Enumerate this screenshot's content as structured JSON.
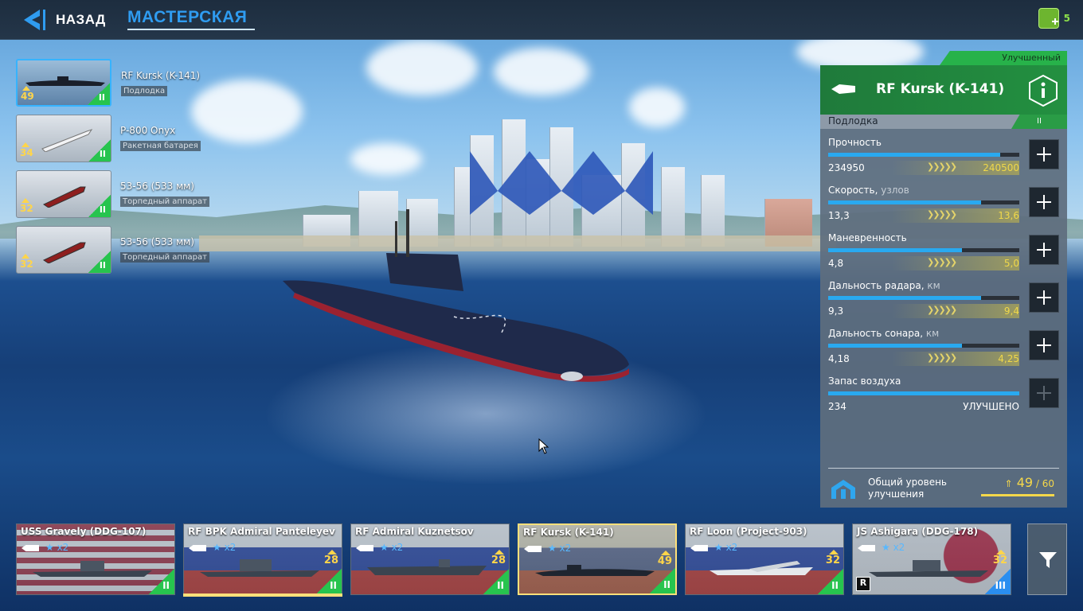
{
  "header": {
    "back_label": "НАЗАД",
    "title": "МАСТЕРСКАЯ",
    "currency_count": "5"
  },
  "loadout": [
    {
      "name": "RF Kursk (K-141)",
      "type": "Подлодка",
      "level": "49",
      "tier": "II",
      "selected": true
    },
    {
      "name": "P-800 Onyx",
      "type": "Ракетная батарея",
      "level": "34",
      "tier": "II",
      "selected": false
    },
    {
      "name": "53-56 (533 мм)",
      "type": "Торпедный аппарат",
      "level": "32",
      "tier": "II",
      "selected": false
    },
    {
      "name": "53-56 (533 мм)",
      "type": "Торпедный аппарат",
      "level": "32",
      "tier": "II",
      "selected": false
    }
  ],
  "panel": {
    "rarity": "Улучшенный",
    "ship_name": "RF Kursk (K-141)",
    "class_label": "Подлодка",
    "tier": "II",
    "stats": [
      {
        "label": "Прочность",
        "unit": "",
        "value": "234950",
        "max": "240500",
        "fill_percent": 90,
        "upgraded": false
      },
      {
        "label": "Скорость,",
        "unit": " узлов",
        "value": "13,3",
        "max": "13,6",
        "fill_percent": 80,
        "upgraded": false
      },
      {
        "label": "Маневренность",
        "unit": "",
        "value": "4,8",
        "max": "5,0",
        "fill_percent": 70,
        "upgraded": false
      },
      {
        "label": "Дальность радара,",
        "unit": " км",
        "value": "9,3",
        "max": "9,4",
        "fill_percent": 80,
        "upgraded": false
      },
      {
        "label": "Дальность сонара,",
        "unit": " км",
        "value": "4,18",
        "max": "4,25",
        "fill_percent": 70,
        "upgraded": false
      },
      {
        "label": "Запас воздуха",
        "unit": "",
        "value": "234",
        "max": "УЛУЧШЕНО",
        "fill_percent": 100,
        "upgraded": true
      }
    ],
    "arrows": "❯❯❯❯❯",
    "total_label_1": "Общий уровень",
    "total_label_2": "улучшения",
    "total_current": "49",
    "total_sep": " / ",
    "total_max": "60"
  },
  "fleet": [
    {
      "name": "USS Gravely (DDG-107)",
      "stars": "x2",
      "level": "",
      "tier": "II",
      "flag": "us",
      "active": false
    },
    {
      "name": "RF BPK Admiral Panteleyev",
      "stars": "x2",
      "level": "28",
      "tier": "II",
      "flag": "ru",
      "active": false
    },
    {
      "name": "RF Admiral Kuznetsov",
      "stars": "x2",
      "level": "28",
      "tier": "II",
      "flag": "ru",
      "active": false
    },
    {
      "name": "RF Kursk (K-141)",
      "stars": "x2",
      "level": "49",
      "tier": "II",
      "flag": "ru",
      "active": true
    },
    {
      "name": "RF Loon (Project-903)",
      "stars": "x2",
      "level": "32",
      "tier": "II",
      "flag": "ru",
      "active": false
    },
    {
      "name": "JS Ashigara (DDG-178)",
      "stars": "x2",
      "level": "32",
      "tier": "III",
      "flag": "jp",
      "active": false
    }
  ],
  "colors": {
    "accent": "#2f9cf0",
    "tier_green": "#27c44e",
    "gold": "#f5d84a",
    "stat_bar": "#29a9f0"
  }
}
